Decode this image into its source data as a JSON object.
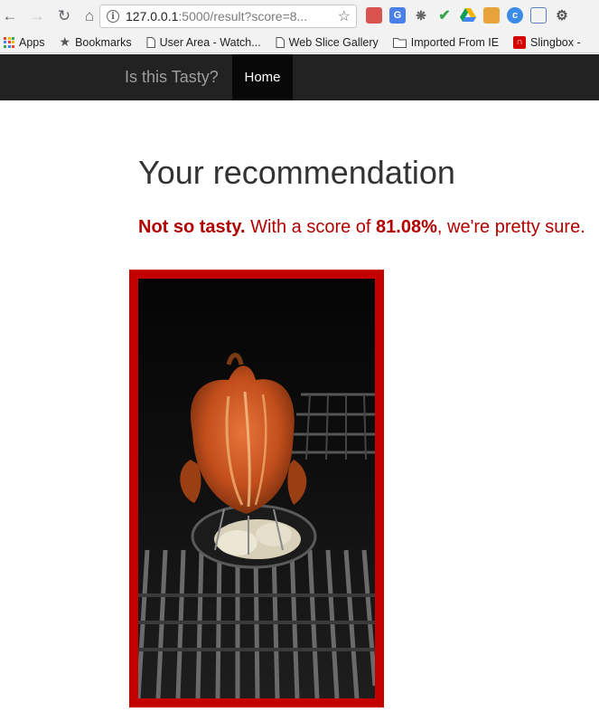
{
  "browser": {
    "url_host": "127.0.0.1",
    "url_path": ":5000/result?score=8...",
    "bookmarks": [
      {
        "label": "Apps",
        "icon": "apps-grid-icon"
      },
      {
        "label": "Bookmarks",
        "icon": "star-icon"
      },
      {
        "label": "User Area - Watch...",
        "icon": "page-icon"
      },
      {
        "label": "Web Slice Gallery",
        "icon": "page-icon"
      },
      {
        "label": "Imported From IE",
        "icon": "folder-icon"
      },
      {
        "label": "Slingbox -",
        "icon": "slingbox-icon"
      }
    ]
  },
  "navbar": {
    "brand": "Is this Tasty?",
    "home_label": "Home"
  },
  "result": {
    "title": "Your recommendation",
    "verdict": "Not so tasty.",
    "text_before_score": " With a score of ",
    "score": "81.08%",
    "text_after_score": ", we're pretty sure."
  },
  "colors": {
    "accent_red": "#b30000",
    "frame_red": "#c40000",
    "navbar_bg": "#222222"
  }
}
